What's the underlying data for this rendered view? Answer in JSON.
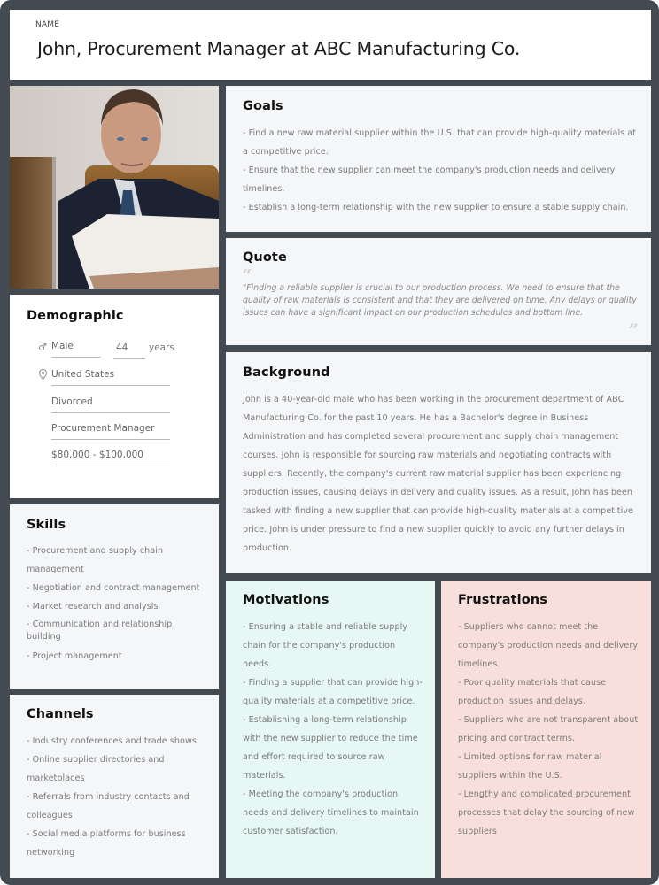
{
  "header": {
    "label": "NAME",
    "title": "John, Procurement Manager at ABC Manufacturing Co."
  },
  "photo": {
    "alt": "Portrait of John at desk with papers and laptop"
  },
  "demographic": {
    "title": "Demographic",
    "gender_icon": "male-symbol-icon",
    "gender": "Male",
    "age": "44",
    "age_unit": "years",
    "location_icon": "location-pin-icon",
    "location": "United States",
    "marital_status": "Divorced",
    "occupation": "Procurement Manager",
    "income": "$80,000 - $100,000"
  },
  "skills": {
    "title": "Skills",
    "items": [
      "- Procurement and supply chain management",
      "- Negotiation and contract management",
      "- Market research and analysis",
      "- Communication and relationship building",
      "- Project management"
    ]
  },
  "channels": {
    "title": "Channels",
    "items": [
      "- Industry conferences and trade shows",
      "- Online supplier directories and marketplaces",
      "- Referrals from industry contacts and colleagues",
      "- Social media platforms for business networking"
    ]
  },
  "goals": {
    "title": "Goals",
    "items": [
      "- Find a new raw material supplier within the U.S. that can provide high-quality materials at a competitive price.",
      "- Ensure that the new supplier can meet the company's production needs and delivery timelines.",
      "- Establish a long-term relationship with the new supplier to ensure a stable supply chain."
    ]
  },
  "quote": {
    "title": "Quote",
    "open_mark": "“",
    "close_mark": "”",
    "text": "\"Finding a reliable supplier is crucial to our production process. We need to ensure that the quality of raw materials is consistent and that they are delivered on time. Any delays or quality issues can have a significant impact on our production schedules and bottom line."
  },
  "background": {
    "title": "Background",
    "text": "John is a 40-year-old male who has been working in the procurement department of ABC Manufacturing Co. for the past 10 years. He has a Bachelor's degree in Business Administration and has completed several procurement and supply chain management courses. John is responsible for sourcing raw materials and negotiating contracts with suppliers. Recently, the company's current raw material supplier has been experiencing production issues, causing delays in delivery and quality issues. As a result, John has been tasked with finding a new supplier that can provide high-quality materials at a competitive price. John is under pressure to find a new supplier quickly to avoid any further delays in production."
  },
  "motivations": {
    "title": "Motivations",
    "items": [
      "- Ensuring a stable and reliable supply chain for the company's production needs.",
      "- Finding a supplier that can provide high-quality materials at a competitive price.",
      "- Establishing a long-term relationship with the new supplier to reduce the time and effort required to source raw materials.",
      "- Meeting the company's production needs and delivery timelines to maintain customer satisfaction."
    ]
  },
  "frustrations": {
    "title": "Frustrations",
    "items": [
      "- Suppliers who cannot meet the company's production needs and delivery timelines.",
      "- Poor quality materials that cause production issues and delays.",
      "- Suppliers who are not transparent about pricing and contract terms.",
      "- Limited options for raw material suppliers within the U.S.",
      "- Lengthy and complicated procurement processes that delay the sourcing of new suppliers"
    ]
  },
  "colors": {
    "frame": "#434a52",
    "panel_white": "#ffffff",
    "panel_gray": "#f5f6f8",
    "motivations_bg": "#e6f7f4",
    "frustrations_bg": "#f9dfdb"
  }
}
